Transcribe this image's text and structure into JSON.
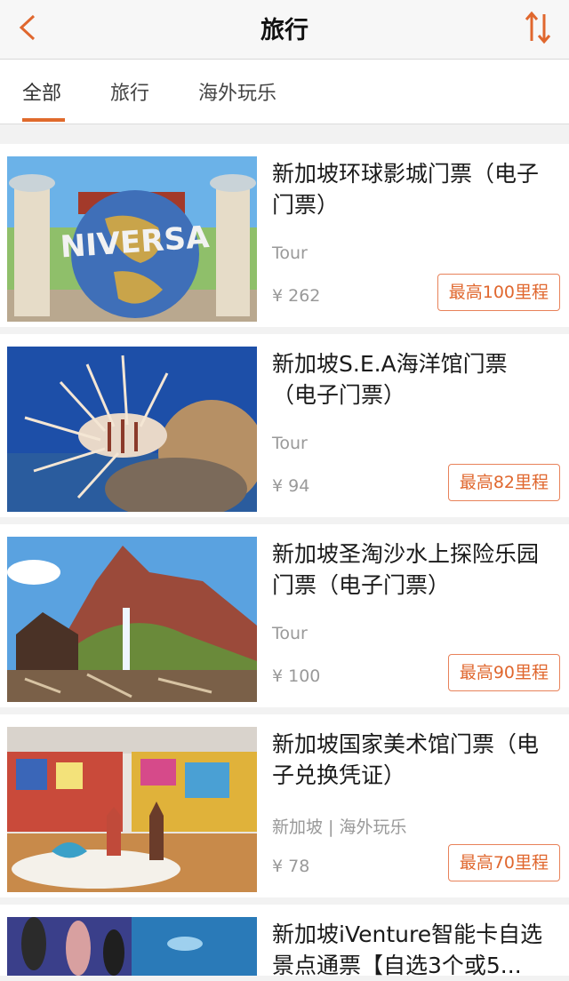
{
  "header": {
    "title": "旅行",
    "back_icon": "chevron-left-icon",
    "sort_icon": "sort-icon",
    "accent": "#e0672e"
  },
  "tabs": [
    {
      "label": "全部",
      "active": true
    },
    {
      "label": "旅行",
      "active": false
    },
    {
      "label": "海外玩乐",
      "active": false
    }
  ],
  "items": [
    {
      "title": "新加坡环球影城门票（电子门票）",
      "subtitle": "Tour",
      "price": "¥ 262",
      "miles": "最高100里程"
    },
    {
      "title": "新加坡S.E.A海洋馆门票（电子门票）",
      "subtitle": "Tour",
      "price": "¥ 94",
      "miles": "最高82里程"
    },
    {
      "title": "新加坡圣淘沙水上探险乐园门票（电子门票）",
      "subtitle": "Tour",
      "price": "¥ 100",
      "miles": "最高90里程"
    },
    {
      "title": "新加坡国家美术馆门票（电子兑换凭证）",
      "subtitle": "新加坡 | 海外玩乐",
      "price": "¥ 78",
      "miles": "最高70里程"
    },
    {
      "title": "新加坡iVenture智能卡自选景点通票【自选3个或5...",
      "subtitle": "",
      "price": "",
      "miles": ""
    }
  ]
}
